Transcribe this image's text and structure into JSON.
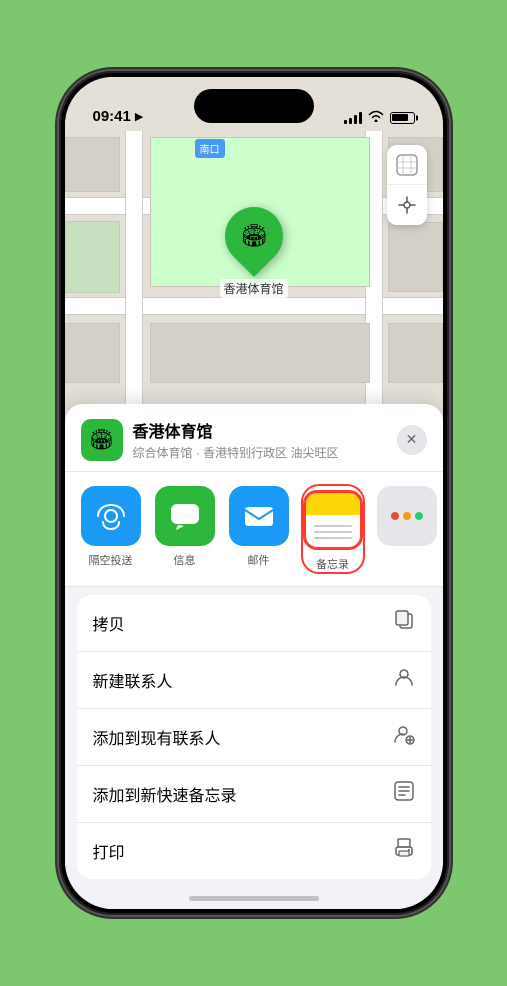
{
  "status": {
    "time": "09:41",
    "location_arrow": "▶"
  },
  "map": {
    "label": "南口",
    "pin_label": "香港体育馆"
  },
  "controls": {
    "map_icon": "🗺",
    "location_icon": "◎"
  },
  "location_card": {
    "name": "香港体育馆",
    "description": "综合体育馆 · 香港特别行政区 油尖旺区",
    "close_label": "✕"
  },
  "share_items": [
    {
      "id": "airdrop",
      "label": "隔空投送"
    },
    {
      "id": "messages",
      "label": "信息"
    },
    {
      "id": "mail",
      "label": "邮件"
    },
    {
      "id": "notes",
      "label": "备忘录"
    }
  ],
  "actions": [
    {
      "label": "拷贝",
      "icon": "📋"
    },
    {
      "label": "新建联系人",
      "icon": "👤"
    },
    {
      "label": "添加到现有联系人",
      "icon": "👤"
    },
    {
      "label": "添加到新快速备忘录",
      "icon": "🗒"
    },
    {
      "label": "打印",
      "icon": "🖨"
    }
  ]
}
